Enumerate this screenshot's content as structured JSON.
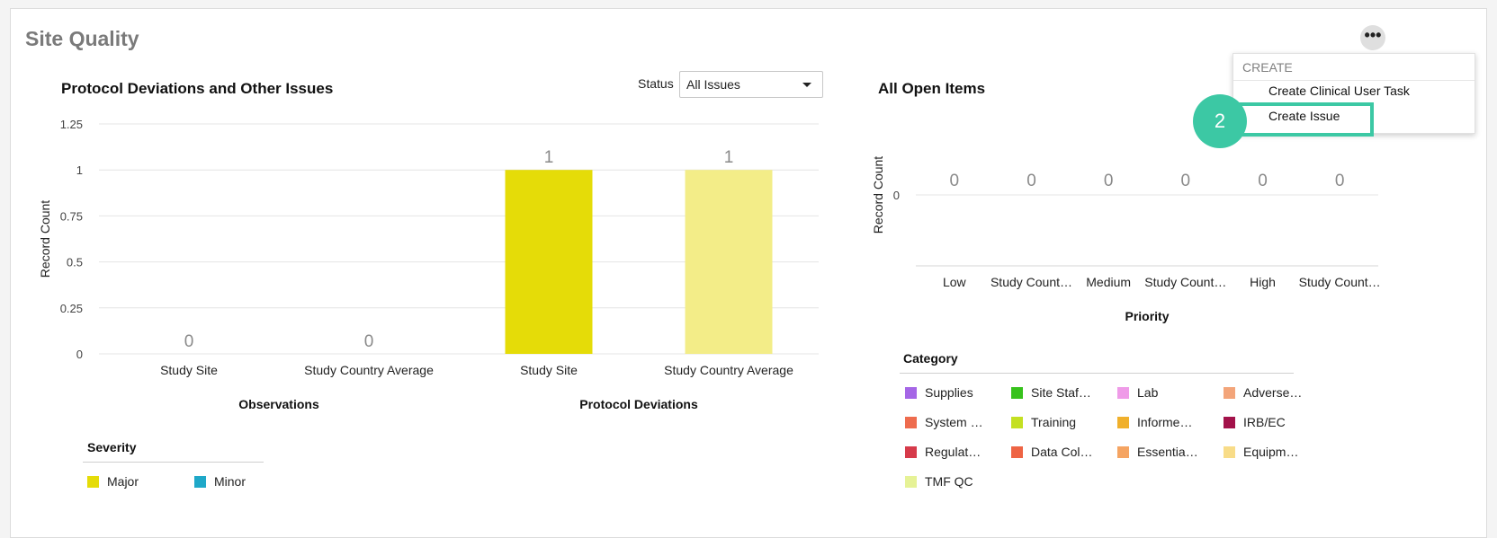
{
  "page": {
    "title": "Site Quality"
  },
  "menu": {
    "header": "CREATE",
    "items": [
      {
        "label": "Create Clinical User Task"
      },
      {
        "label": "Create Issue"
      }
    ]
  },
  "tutorial": {
    "step": "2",
    "accent": "#3cc8a4"
  },
  "left_chart": {
    "title": "Protocol Deviations and Other Issues",
    "status_label": "Status",
    "status_value": "All Issues",
    "legend": {
      "title": "Severity",
      "items": [
        {
          "label": "Major",
          "color": "#e5dc08"
        },
        {
          "label": "Minor",
          "color": "#1fa8c8"
        }
      ]
    }
  },
  "right_chart": {
    "title": "All Open Items",
    "legend": {
      "title": "Category",
      "items": [
        {
          "label": "Supplies",
          "color": "#a566e6"
        },
        {
          "label": "Site Staf…",
          "color": "#37c21c"
        },
        {
          "label": "Lab",
          "color": "#ef9be8"
        },
        {
          "label": "Adverse…",
          "color": "#f3a57a"
        },
        {
          "label": "System …",
          "color": "#ee6c4e"
        },
        {
          "label": "Training",
          "color": "#c4e022"
        },
        {
          "label": "Informe…",
          "color": "#f0b02c"
        },
        {
          "label": "IRB/EC",
          "color": "#a3124a"
        },
        {
          "label": "Regulat…",
          "color": "#d63a4a"
        },
        {
          "label": "Data Col…",
          "color": "#ee6444"
        },
        {
          "label": "Essentia…",
          "color": "#f5a462"
        },
        {
          "label": "Equipm…",
          "color": "#f8dc88"
        },
        {
          "label": "TMF QC",
          "color": "#e6f296"
        }
      ]
    }
  },
  "chart_data": [
    {
      "type": "bar",
      "categories": [
        "Study Site",
        "Study Country Average",
        "Study Site",
        "Study Country Average"
      ],
      "groups": [
        {
          "label": "Observations",
          "categories": [
            "Study Site",
            "Study Country Average"
          ]
        },
        {
          "label": "Protocol Deviations",
          "categories": [
            "Study Site",
            "Study Country Average"
          ]
        }
      ],
      "values": [
        0,
        0,
        1,
        1
      ],
      "bar_colors": [
        "#e5dc08",
        "#e5dc08",
        "#e5dc08",
        "#f3ed88"
      ],
      "ylabel": "Record Count",
      "ylim": [
        0,
        1.25
      ],
      "yticks": [
        "0",
        "0.25",
        "0.5",
        "0.75",
        "1",
        "1.25"
      ],
      "grid": true
    },
    {
      "type": "bar",
      "categories": [
        "Low",
        "Study Count…",
        "Medium",
        "Study Count…",
        "High",
        "Study Count…"
      ],
      "values": [
        0,
        0,
        0,
        0,
        0,
        0
      ],
      "xlabel": "Priority",
      "ylabel": "Record Count",
      "yticks": [
        "0"
      ],
      "grid": true
    }
  ]
}
